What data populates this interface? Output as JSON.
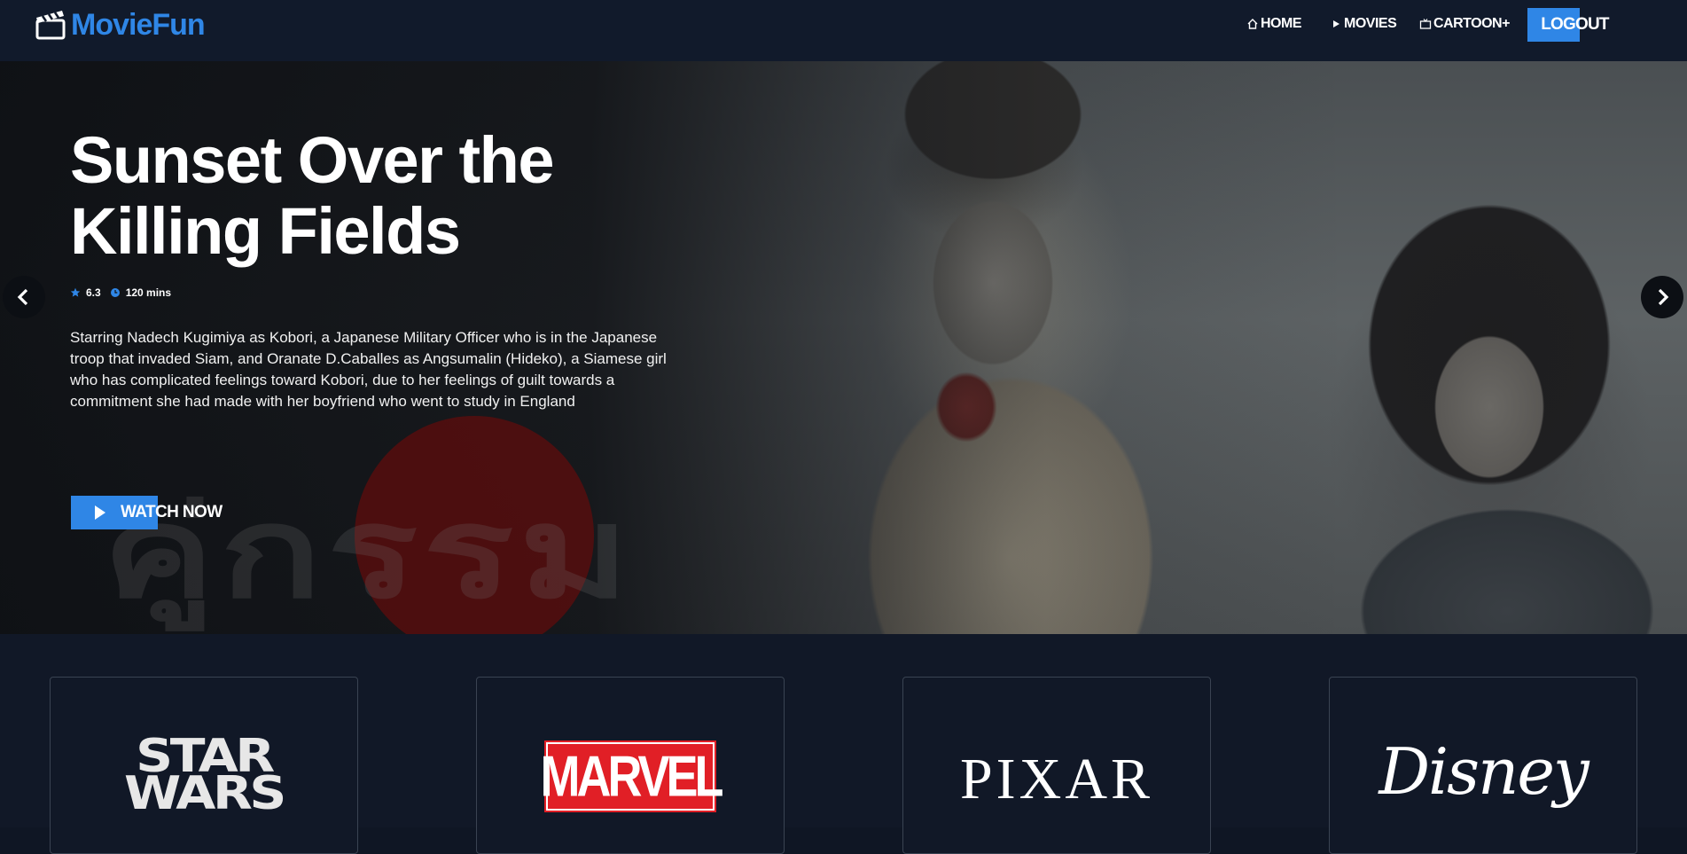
{
  "navbar": {
    "brand": "MovieFun",
    "brand_icon": "clapperboard-icon",
    "links": {
      "home": "HOME",
      "movies": "MOVIES",
      "cartoon": "CARTOON+"
    },
    "logout_label": "LOGOUT",
    "accent_color": "#2f86e6"
  },
  "hero": {
    "title": "Sunset Over the Killing Fields",
    "rating": "6.3",
    "duration": "120 mins",
    "description": "Starring Nadech Kugimiya as Kobori, a Japanese Military Officer who is in the Japanese troop that invaded Siam, and Oranate D.Caballes as Angsumalin (Hideko), a Siamese girl who has complicated feelings toward Kobori, due to her feelings of guilt towards a commitment she had made with her boyfriend who went to study in England",
    "watch_label": "WATCH NOW",
    "watermark": "คู่กรรม",
    "icons": {
      "rating": "star-icon",
      "duration": "clock-icon",
      "watch": "play-icon",
      "prev": "chevron-left-icon",
      "next": "chevron-right-icon"
    }
  },
  "studios": [
    {
      "name": "STAR WARS",
      "line1": "STAR",
      "line2": "WARS"
    },
    {
      "name": "MARVEL"
    },
    {
      "name": "PIXAR"
    },
    {
      "name": "Disney"
    }
  ]
}
